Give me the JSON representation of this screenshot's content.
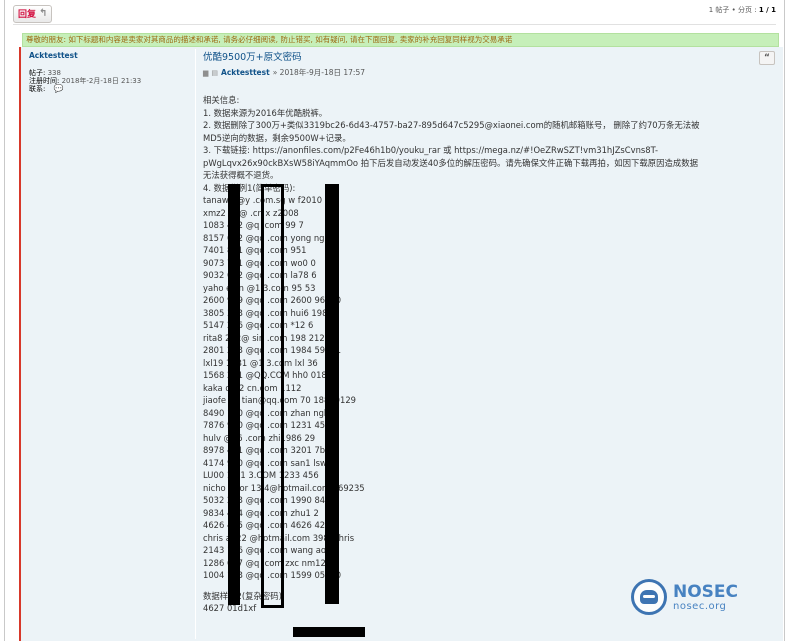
{
  "toolbar": {
    "reply_label": "回复",
    "reply_icon": "reply-arrow-icon"
  },
  "pagination": {
    "text_prefix": "1 帖子 • 分页 : ",
    "current": "1 / 1"
  },
  "notice": "尊敬的朋友: 如下标题和内容是卖家对其商品的描述和承诺, 请务必仔细阅读, 防止错买, 如有疑问, 请在下面回复, 卖家的补充回复同样视为交易承诺",
  "profile": {
    "username": "Acktesttest",
    "posts_label": "帖子:",
    "posts_value": "338",
    "joined_label": "注册时间:",
    "joined_value": "2018年-2月-18日 21:33",
    "contact_label": "联系:"
  },
  "post": {
    "title": "优酷9500万+原文密码",
    "author": "Acktesttest",
    "timestamp": "» 2018年-9月-18日 17:57",
    "quote_label": "“",
    "lines": [
      "相关信息:",
      "1. 数据来源为2016年优酷脱裤。",
      "2. 数据删除了300万+类似3319bc26-6d43-4757-ba27-895d647c5295@xiaonei.com的随机邮箱账号， 删除了约70万条无法被",
      "MD5逆向的数据，剩余9500W+记录。",
      "3. 下载链接: https://anonfiles.com/p2Fe46h1b0/youku_rar 或 https://mega.nz/#!OeZRwSZT!vm31hJZsCvns8T-",
      "pWgLqvx26x90ckBXsW58iYAqmmOo 拍下后发自动发送40多位的解压密码。请先确保文件正确下载再拍，如因下载原因造成数据",
      "无法获得概不退货。",
      "4. 数据样例1(简单密码):",
      "tanaw  6@y      .com.sg w   f2010",
      "xmz2  08@      .cn x   z2008",
      "1083  412  @q  .com 99   7",
      "8157  612  @qq .com yong  ng",
      "7401  801  @qq .com 951",
      "9073  731  @qq .com wo0   0",
      "9032  662  @qq .com la78   6",
      "yaho  evin  @1  3.com 95   53",
      "2600  969  @qq .com 2600   96900",
      "3805  373  @qq .com hui6   1989",
      "5147  276  @qq .com *12   6",
      "rita8  212@  sin  .com 198   212rita",
      "2801  283  @qq .com 1984   59831",
      "lxl19  1131  @1  3.com lxl   36",
      "1568  231  @QQ.COM hh0   018",
      "kaka  d@2  cn.com 1112",
      "jiaofe  fei  tian@qq.com 70   18870129",
      "8490  170  @qq .com zhan   nghui",
      "7876  960  @qq .com 1231   456",
      "hulv  @16  .com zhi1986   29",
      "8978  401  @qq .com 3201   7biao",
      "4174  930  @qq .com san1   lsw",
      "LU00  1@1  3.COM 1233   456",
      "nicho  swor  13   4@hotmail.com 269235",
      "5032  293  @qq .com 1990   8405",
      "9834  494  @qq .com zhu1   2",
      "4626  425  @qq .com 4626   425",
      "chris  a422  @hotmail.com  3984chris",
      "2143  186  @qq .com wang   aoyu",
      "1286  617  @q  .com zxc   nm123",
      "1004  183  @qq .com 1599   05380",
      "",
      "数据样例2(复杂密码):",
      "4627                 01d1xf"
    ]
  },
  "watermark": {
    "brand": "NOSEC",
    "domain": "nosec.org"
  },
  "colors": {
    "accent_red": "#d31141",
    "link_blue": "#105289",
    "notice_bg": "#c6efb9",
    "notice_text": "#9c6a12",
    "post_bg": "#ecf3f7"
  }
}
